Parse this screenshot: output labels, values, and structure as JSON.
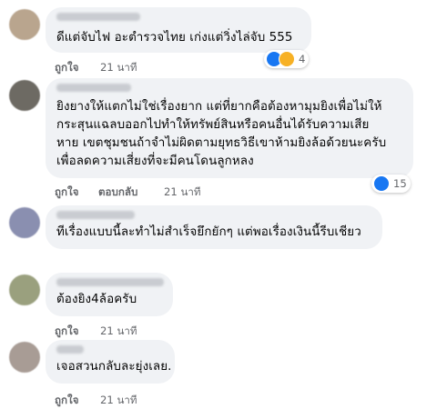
{
  "comments": [
    {
      "text": "ดีแต่จับไฟ อะตำรวจไทย เก่งแต่วิ่งไล่จับ 555",
      "actions": {
        "like": "ถูกใจ",
        "time": "21 นาที"
      },
      "reactions": {
        "icons": [
          "like-icon",
          "haha-icon"
        ],
        "count": "4"
      },
      "avatar_color": "#b9a58e"
    },
    {
      "lines": [
        "ยิงยางให้แตกไม่ใช่เรื่องยาก แต่ที่ยากคือต้องหามุมยิงเพื่อไม่ให้",
        "กระสุนแฉลบออกไปทำให้ทรัพย์สินหรือคนอื่นได้รับความเสีย",
        "หาย เขตชุมชนถ้าจำไม่ผิดตามยุทธวิธีเขาห้ามยิงล้อด้วยนะครับ",
        "เพื่อลดความเสี่ยงที่จะมีคนโดนลูกหลง"
      ],
      "actions": {
        "like": "ถูกใจ",
        "reply": "ตอบกลับ",
        "time": "21 นาที"
      },
      "reactions": {
        "icons": [
          "like-icon"
        ],
        "count": "15"
      },
      "avatar_color": "#6d6a63"
    },
    {
      "text": "ทีเรื่องแบบนี้ละทำไม่สำเร็จยึกยักๆ แต่พอเรื่องเงินนี้รีบเชียว",
      "avatar_color": "#8a8fb0"
    },
    {
      "text": "ต้องยิง4ล้อครับ",
      "actions": {
        "like": "ถูกใจ",
        "time": "21 นาที"
      },
      "avatar_color": "#9aa07e"
    },
    {
      "text": "เจอสวนกลับละยุ่งเลย.",
      "actions": {
        "like": "ถูกใจ",
        "time": "21 นาที"
      },
      "avatar_color": "#a89c95"
    }
  ],
  "colors": {
    "bubble": "#f0f2f5",
    "meta": "#65676b",
    "like_blue": "#1877f2",
    "haha_yellow": "#f7b125"
  }
}
